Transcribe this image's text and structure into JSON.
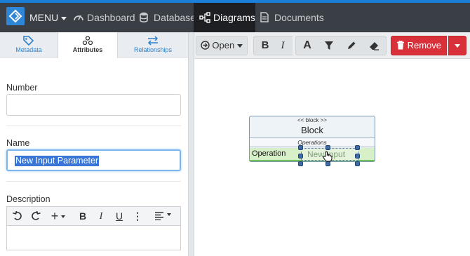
{
  "nav": {
    "menu_label": "MENU",
    "items": [
      {
        "label": "Dashboard",
        "icon": "dashboard-icon"
      },
      {
        "label": "Database",
        "icon": "database-icon"
      },
      {
        "label": "Diagrams",
        "icon": "diagrams-icon",
        "active": true
      },
      {
        "label": "Documents",
        "icon": "document-icon"
      }
    ]
  },
  "left_panel": {
    "tabs": [
      {
        "label": "Metadata",
        "icon": "tag-icon"
      },
      {
        "label": "Attributes",
        "icon": "attributes-icon",
        "active": true
      },
      {
        "label": "Relationships",
        "icon": "relationships-icon"
      }
    ],
    "number": {
      "label": "Number",
      "value": ""
    },
    "name": {
      "label": "Name",
      "value": "New Input Parameter"
    },
    "description": {
      "label": "Description",
      "value": ""
    }
  },
  "toolbar": {
    "open_label": "Open",
    "remove_label": "Remove"
  },
  "diagram": {
    "block": {
      "stereotype": "<< block >>",
      "name": "Block",
      "ops_header": "Operations",
      "operation_label": "Operation",
      "editing_text": "New Input"
    }
  },
  "colors": {
    "accent": "#1a7fd9",
    "nav_bg": "#3a3f46",
    "danger": "#d9313a",
    "selection": "#3875d7"
  }
}
